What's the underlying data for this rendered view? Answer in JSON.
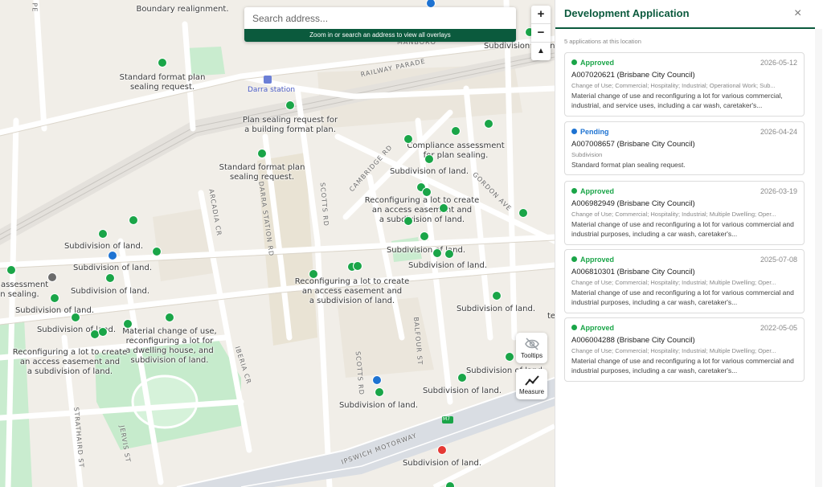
{
  "map": {
    "search": {
      "placeholder": "Search address...",
      "hint": "Zoom in or search an address to view all overlays"
    },
    "zoom": {
      "in": "+",
      "out": "−",
      "north": "▲"
    },
    "tools": [
      {
        "label": "Tooltips",
        "icon": "eye-off-icon"
      },
      {
        "label": "Measure",
        "icon": "chart-line-icon"
      }
    ],
    "streets": {
      "railway_parade": "RAILWAY PARADE",
      "manboro": "MANBORO",
      "cambridge_rd": "CAMBRIDGE RD",
      "gordon_ave": "GORDON AVE",
      "arcadia_cr": "ARCADIA CR",
      "darra_station_rd": "DARRA STATION RD",
      "scotts_rd": "SCOTTS RD",
      "scotts_rd_2": "SCOTTS RD",
      "balfour_st": "BALFOUR ST",
      "iberia_cr": "IBERIA CR",
      "strathaird_st": "STRATHAIRD ST",
      "jervis_st": "JERVIS ST",
      "ipswich_motorway": "IPSWICH MOTORWAY",
      "m7_shield": "M7",
      "darra_station": "Darra station",
      "edge_p": "PE",
      "edge_te": "te"
    },
    "labels": [
      "Boundary realignment.",
      "Standard format plan\nsealing request.",
      "Plan sealing request for\na building format plan.",
      "Standard format plan\nsealing request.",
      "Compliance assessment\nfor plan sealing.",
      "Subdivision of land.",
      "Reconfiguring a lot to create\nan access easement and\na subdivision of land.",
      "Subdivision of land.",
      "Subdivision of land.",
      "Subdivision of land.",
      "Subdivision of land.",
      "Subdivision of land.",
      "nce assessment\nlan sealing.",
      "Subdivision of land.",
      "Reconfiguring a lot to create\nan access easement and\na subdivision of land.",
      "Subdivision of land.",
      "Material change of use,\nreconfiguring a lot for\na dwelling house, and\nsubdivision of land.",
      "Reconfiguring a lot to create\nan access easement and\na subdivision of land.",
      "Subdivision of land.",
      "Subdivision of land.",
      "Subdivision of land.",
      "Subdivision of land.",
      "Subdivision of land.",
      "Standard format\nsealing request",
      "Subdivision of land."
    ],
    "status_colors": {
      "approved": "#1aa548",
      "pending": "#1e73d2",
      "refused": "#e53935",
      "withdrawn": "#6b6b6b"
    }
  },
  "panel": {
    "title": "Development Application",
    "close": "×",
    "count_text": "5 applications at this location",
    "applications": [
      {
        "status": "Approved",
        "status_color": "#1aa548",
        "date": "2026-05-12",
        "id": "A007020621 (Brisbane City Council)",
        "categories": "Change of Use; Commercial; Hospitality; Industrial; Operational Work; Sub...",
        "description": "Material change of use and reconfiguring a lot for various commercial, industrial, and service uses, including a car wash, caretaker's..."
      },
      {
        "status": "Pending",
        "status_color": "#1e73d2",
        "date": "2026-04-24",
        "id": "A007008657 (Brisbane City Council)",
        "categories": "Subdivision",
        "description": "Standard format plan sealing request."
      },
      {
        "status": "Approved",
        "status_color": "#1aa548",
        "date": "2026-03-19",
        "id": "A006982949 (Brisbane City Council)",
        "categories": "Change of Use; Commercial; Hospitality; Industrial; Multiple Dwelling; Oper...",
        "description": "Material change of use and reconfiguring a lot for various commercial and industrial purposes, including a car wash, caretaker's..."
      },
      {
        "status": "Approved",
        "status_color": "#1aa548",
        "date": "2025-07-08",
        "id": "A006810301 (Brisbane City Council)",
        "categories": "Change of Use; Commercial; Hospitality; Industrial; Multiple Dwelling; Oper...",
        "description": "Material change of use and reconfiguring a lot for various commercial and industrial purposes, including a car wash, caretaker's..."
      },
      {
        "status": "Approved",
        "status_color": "#1aa548",
        "date": "2022-05-05",
        "id": "A006004288 (Brisbane City Council)",
        "categories": "Change of Use; Commercial; Hospitality; Industrial; Multiple Dwelling; Oper...",
        "description": "Material change of use and reconfiguring a lot for various commercial and industrial purposes, including a car wash, caretaker's..."
      }
    ]
  }
}
